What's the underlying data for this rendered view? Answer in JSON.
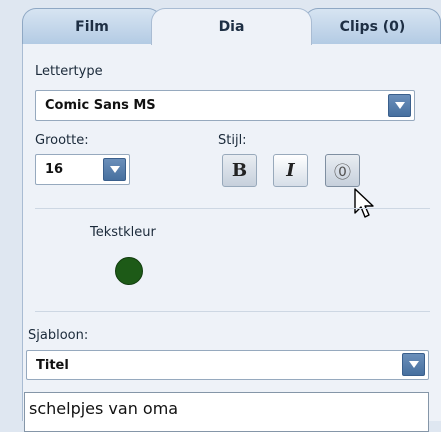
{
  "tabs": [
    {
      "label": "Film"
    },
    {
      "label": "Dia"
    },
    {
      "label": "Clips (0)"
    }
  ],
  "font": {
    "label": "Lettertype",
    "value": "Comic Sans MS"
  },
  "size": {
    "label": "Grootte:",
    "value": "16"
  },
  "style": {
    "label": "Stijl:",
    "bold": "B",
    "italic": "I",
    "outline": "⓪"
  },
  "color": {
    "label": "Tekstkleur",
    "value": "#1d5a17"
  },
  "template": {
    "label": "Sjabloon:",
    "value": "Titel"
  },
  "text": {
    "value": "schelpjes van oma"
  },
  "colors": {
    "accent": "#47709f",
    "background": "#dfe7f1",
    "panel": "#eef2f8"
  }
}
